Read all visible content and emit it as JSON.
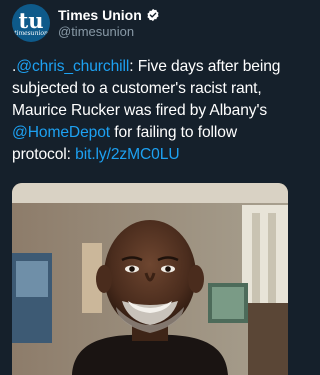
{
  "account": {
    "avatar_main": "tu",
    "avatar_sub": "timesunion",
    "display_name": "Times Union",
    "handle": "@timesunion",
    "verified": true
  },
  "tweet": {
    "prefix": ".",
    "mention_1": "@chris_churchill",
    "text_1": ": Five days after being subjected to a customer's racist rant, Maurice Rucker was fired by Albany's ",
    "mention_2": "@HomeDepot",
    "text_2": " for failing to follow protocol: ",
    "url": "bit.ly/2zMC0LU"
  },
  "media": {
    "type": "photo"
  },
  "colors": {
    "background": "#15202b",
    "link": "#1da1f2",
    "secondary_text": "#8899a6",
    "verified_badge": "#ffffff",
    "avatar_bg": "#0e5a8a"
  },
  "icons": {
    "verified": "verified-badge-icon"
  }
}
